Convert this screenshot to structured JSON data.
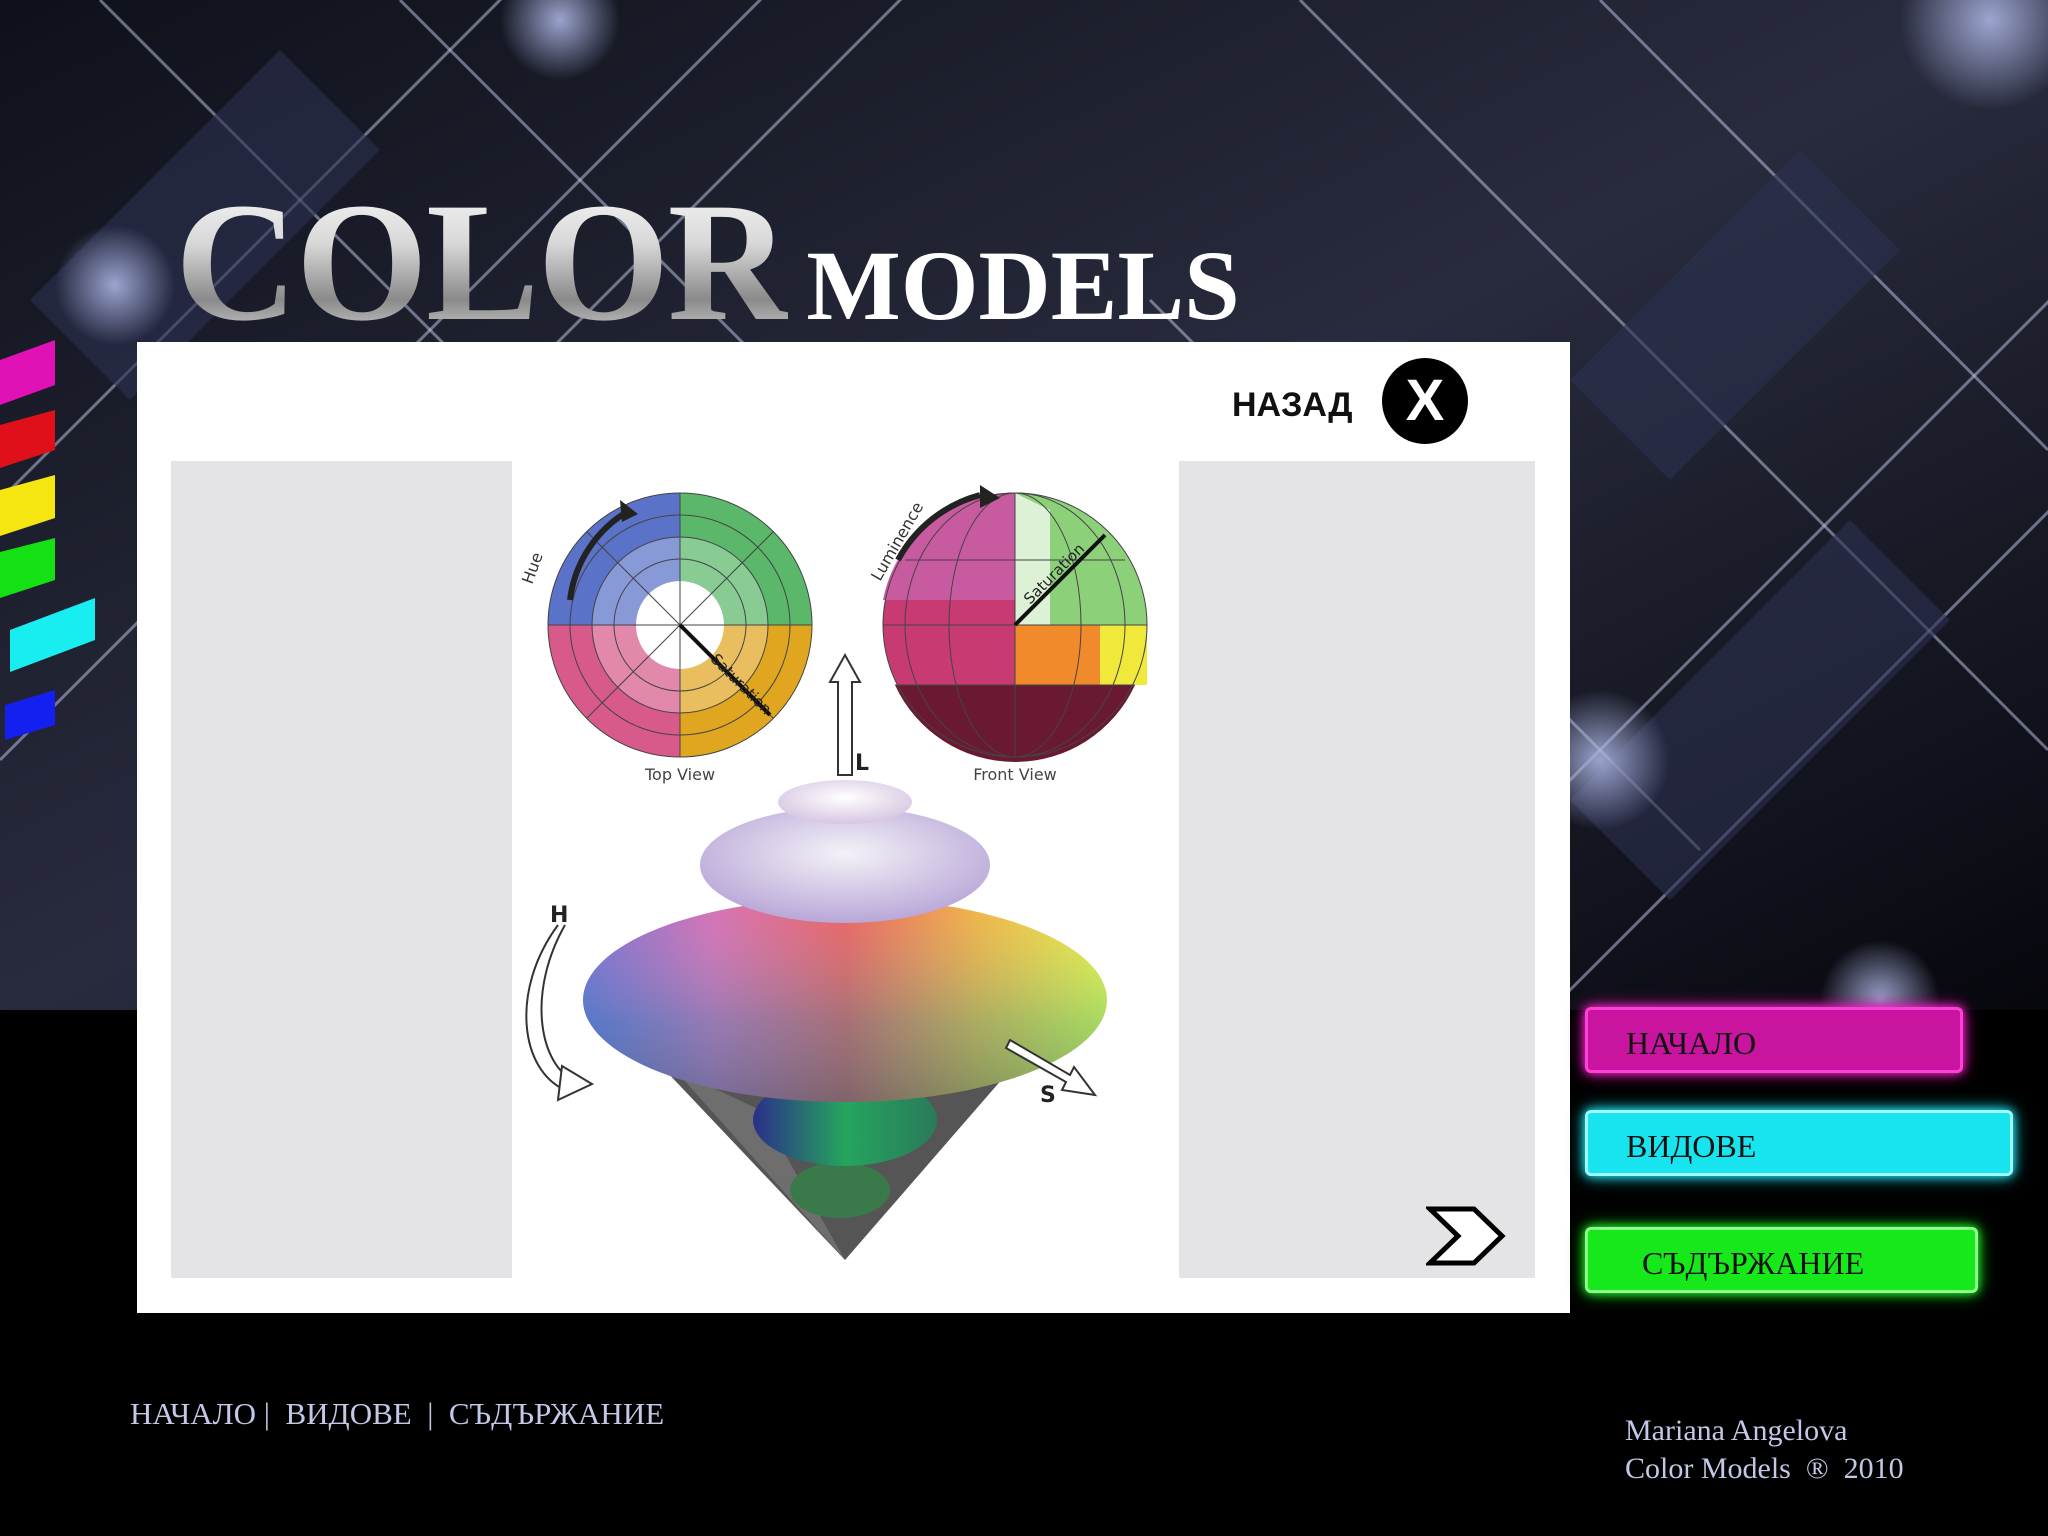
{
  "header": {
    "title_word1": "COLOR",
    "title_word2": "MODELS"
  },
  "panel": {
    "back_label": "НАЗАД",
    "close_symbol": "X"
  },
  "diagram": {
    "top_view_caption": "Top View",
    "front_view_caption": "Front View",
    "hue_label": "Hue",
    "saturation_label": "Saturation",
    "luminence_label": "Luminence",
    "axis_l": "L",
    "axis_h": "H",
    "axis_s": "S"
  },
  "nav": {
    "home": "НАЧАЛО",
    "types": "ВИДОВЕ",
    "contents": "СЪДЪРЖАНИЕ"
  },
  "footer": {
    "link_home": "НАЧАЛО",
    "link_types": "ВИДОВЕ",
    "link_contents": "СЪДЪРЖАНИЕ",
    "separator": "|",
    "author": "Mariana Angelova",
    "copyright": "Color Models  ®  2010"
  },
  "colors": {
    "home_button": "#c8149e",
    "types_button": "#18e4ef",
    "contents_button": "#16e81a",
    "footer_text": "#c2c8e6"
  }
}
